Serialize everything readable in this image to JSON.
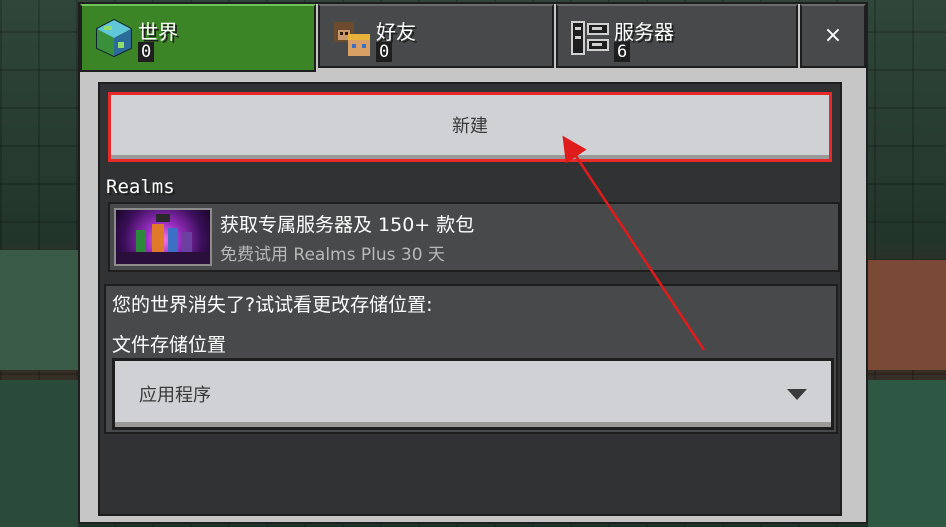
{
  "tabs": [
    {
      "label": "世界",
      "count": "0",
      "icon": "world-globe-icon",
      "active": true
    },
    {
      "label": "好友",
      "count": "0",
      "icon": "friends-avatars-icon",
      "active": false
    },
    {
      "label": "服务器",
      "count": "6",
      "icon": "server-icon",
      "active": false
    }
  ],
  "close_label": "×",
  "new_button_label": "新建",
  "realms": {
    "heading": "Realms",
    "title": "获取专属服务器及 150+ 款包",
    "subtitle": "免费试用 Realms Plus 30 天"
  },
  "storage": {
    "message": "您的世界消失了?试试看更改存储位置:",
    "label": "文件存储位置",
    "selected": "应用程序"
  },
  "colors": {
    "active_tab": "#3c8527",
    "highlight_border": "#e62a2a",
    "annotation_arrow": "#e01b1b"
  }
}
